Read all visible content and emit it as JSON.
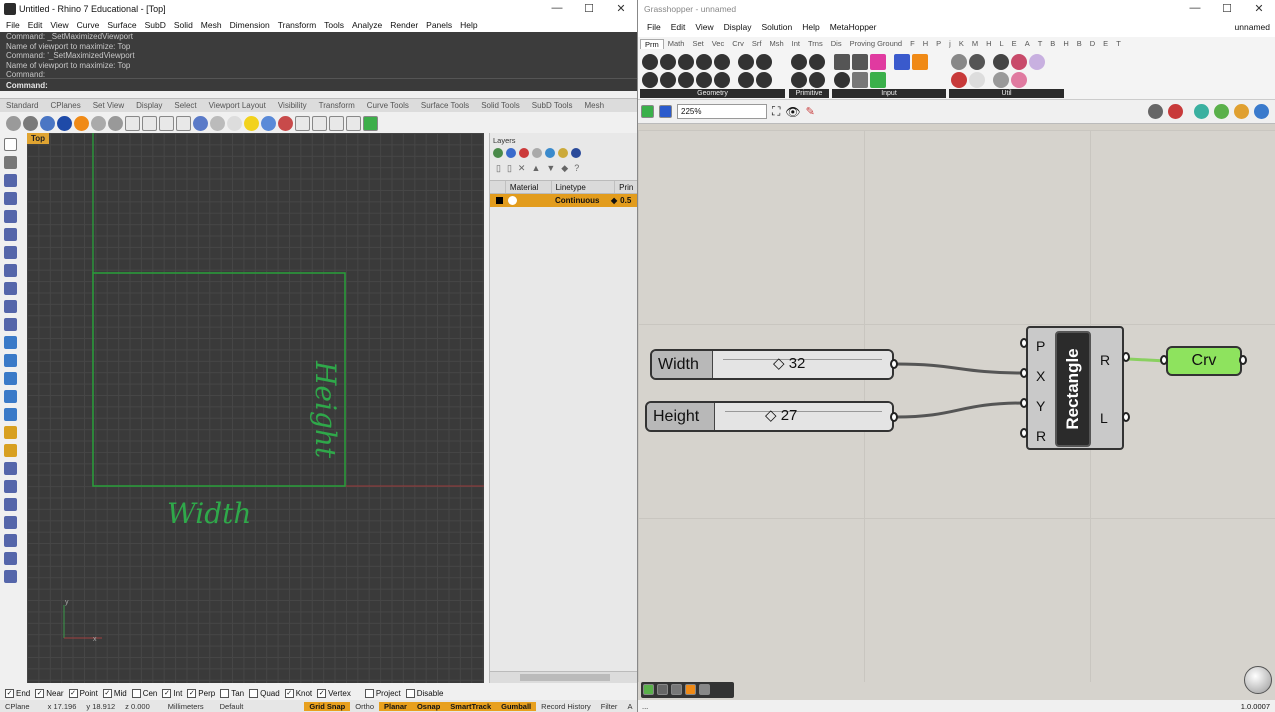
{
  "rhino": {
    "title": "Untitled - Rhino 7 Educational - [Top]",
    "window_buttons": [
      "—",
      "☐",
      "✕"
    ],
    "menu": [
      "File",
      "Edit",
      "View",
      "Curve",
      "Surface",
      "SubD",
      "Solid",
      "Mesh",
      "Dimension",
      "Transform",
      "Tools",
      "Analyze",
      "Render",
      "Panels",
      "Help"
    ],
    "command_history": [
      "Command: _SetMaximizedViewport",
      "Name of viewport to maximize: Top",
      "Command: '_SetMaximizedViewport",
      "Name of viewport to maximize: Top",
      "Command:"
    ],
    "command_prompt": "Command:",
    "toolbar_tabs": [
      "Standard",
      "CPlanes",
      "Set View",
      "Display",
      "Select",
      "Viewport Layout",
      "Visibility",
      "Transform",
      "Curve Tools",
      "Surface Tools",
      "Solid Tools",
      "SubD Tools",
      "Mesh"
    ],
    "viewport_label": "Top",
    "annotations": {
      "width": "Width",
      "height": "Height"
    },
    "axis": {
      "x": "x",
      "y": "y"
    },
    "layers": {
      "title": "Layers",
      "columns": [
        "Material",
        "Linetype",
        "Prin"
      ],
      "row": {
        "linetype": "Continuous",
        "print": "0.5"
      }
    },
    "osnaps": [
      {
        "label": "End",
        "checked": true
      },
      {
        "label": "Near",
        "checked": true
      },
      {
        "label": "Point",
        "checked": true
      },
      {
        "label": "Mid",
        "checked": true
      },
      {
        "label": "Cen",
        "checked": false
      },
      {
        "label": "Int",
        "checked": true
      },
      {
        "label": "Perp",
        "checked": true
      },
      {
        "label": "Tan",
        "checked": false
      },
      {
        "label": "Quad",
        "checked": false
      },
      {
        "label": "Knot",
        "checked": true
      },
      {
        "label": "Vertex",
        "checked": true
      },
      {
        "label": "Project",
        "checked": false
      },
      {
        "label": "Disable",
        "checked": false
      }
    ],
    "status": {
      "cplane": "CPlane",
      "x": "x 17.196",
      "y": "y 18.912",
      "z": "z 0.000",
      "units": "Millimeters",
      "layer": "Default",
      "grid_snap": "Grid Snap",
      "ortho": "Ortho",
      "planar": "Planar",
      "osnap": "Osnap",
      "smarttrack": "SmartTrack",
      "gumball": "Gumball",
      "history": "Record History",
      "filter": "Filter",
      "filter_more": "A"
    }
  },
  "gh": {
    "title": "Grasshopper - unnamed",
    "menu": [
      "File",
      "Edit",
      "View",
      "Display",
      "Solution",
      "Help",
      "MetaHopper"
    ],
    "doc_name": "unnamed",
    "tabs": [
      "Prm",
      "Math",
      "Set",
      "Vec",
      "Crv",
      "Srf",
      "Msh",
      "Int",
      "Trns",
      "Dis",
      "Proving Ground",
      "F",
      "H",
      "P",
      "j",
      "K",
      "M",
      "H",
      "L",
      "E",
      "A",
      "T",
      "B",
      "H",
      "B",
      "D",
      "E",
      "T"
    ],
    "ribbon_groups": [
      "Geometry",
      "Primitive",
      "Input",
      "Util"
    ],
    "zoom": "225%",
    "sliders": [
      {
        "label": "Width",
        "value": "32",
        "value_num": 32
      },
      {
        "label": "Height",
        "value": "27",
        "value_num": 27
      }
    ],
    "component": {
      "name": "Rectangle",
      "inputs": [
        "P",
        "X",
        "Y",
        "R"
      ],
      "outputs": [
        "R",
        "L"
      ]
    },
    "output_param": "Crv",
    "version": "1.0.0007",
    "status_left": "...",
    "colors": {
      "curve_green": "#2a9a3a",
      "crv_fill": "#8ee35e",
      "layer_highlight": "#e29c1d"
    }
  }
}
